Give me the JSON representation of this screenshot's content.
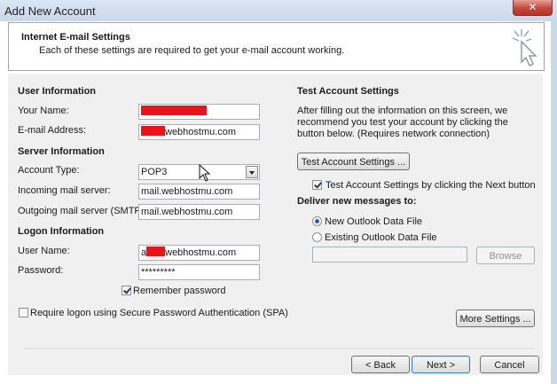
{
  "window": {
    "title": "Add New Account",
    "close_label": "✕"
  },
  "header": {
    "title": "Internet E-mail Settings",
    "subtitle": "Each of these settings are required to get your e-mail account working.",
    "icon": "cursor-click-icon"
  },
  "user_info": {
    "section": "User Information",
    "name_label": "Your Name:",
    "name_value": "",
    "email_label": "E-mail Address:",
    "email_value_suffix": "webhostmu.com"
  },
  "server_info": {
    "section": "Server Information",
    "account_type_label": "Account Type:",
    "account_type_value": "POP3",
    "incoming_label": "Incoming mail server:",
    "incoming_value": "mail.webhostmu.com",
    "outgoing_label": "Outgoing mail server (SMTP):",
    "outgoing_value": "mail.webhostmu.com"
  },
  "logon_info": {
    "section": "Logon Information",
    "username_label": "User Name:",
    "username_prefix": "a",
    "username_suffix": "webhostmu.com",
    "password_label": "Password:",
    "password_value": "*********",
    "remember_label": "Remember password",
    "remember_checked": true,
    "spa_label": "Require logon using Secure Password Authentication (SPA)",
    "spa_checked": false
  },
  "test_settings": {
    "section": "Test Account Settings",
    "description": "After filling out the information on this screen, we recommend you test your account by clicking the button below. (Requires network connection)",
    "test_button": "Test Account Settings ...",
    "test_next_label": "Test Account Settings by clicking the Next button",
    "test_next_checked": true
  },
  "deliver": {
    "section": "Deliver new messages to:",
    "new_file_label": "New Outlook Data File",
    "existing_file_label": "Existing Outlook Data File",
    "selected": "new",
    "existing_path": "",
    "browse_button": "Browse"
  },
  "buttons": {
    "more_settings": "More Settings ...",
    "back": "< Back",
    "next": "Next >",
    "cancel": "Cancel"
  },
  "colors": {
    "redaction": "#e8141a",
    "accent": "#3c7fb1"
  }
}
